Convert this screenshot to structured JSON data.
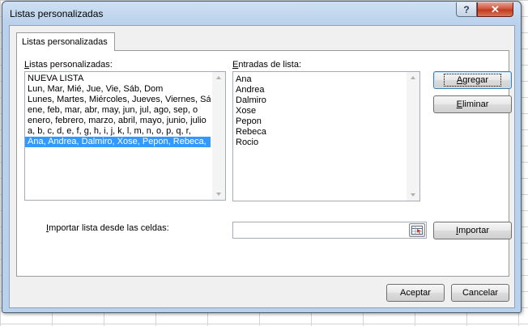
{
  "window": {
    "title": "Listas personalizadas",
    "help": "?",
    "close": "✕"
  },
  "tab": {
    "label": "Listas personalizadas"
  },
  "custom_lists": {
    "label_before": "",
    "label_accel": "L",
    "label_after": "istas personalizadas:",
    "items": [
      "NUEVA LISTA",
      "Lun, Mar, Mié, Jue, Vie, Sáb, Dom",
      "Lunes, Martes, Miércoles, Jueves, Viernes, Sá",
      "ene, feb, mar, abr, may, jun, jul, ago, sep, o",
      "enero, febrero, marzo, abril, mayo, junio, julio",
      "a, b, c, d, e, f, g, h, i, j, k, l, m, n, o, p, q, r,",
      "Ana, Andrea, Dalmiro, Xose, Pepon, Rebeca,"
    ],
    "selected_index": 6
  },
  "list_entries": {
    "label_before": "",
    "label_accel": "E",
    "label_after": "ntradas de lista:",
    "items": [
      "Ana",
      "Andrea",
      "Dalmiro",
      "Xose",
      "Pepon",
      "Rebeca",
      "Rocio"
    ]
  },
  "buttons": {
    "add": {
      "accel": "A",
      "rest": "gregar"
    },
    "delete": {
      "accel": "E",
      "rest": "liminar"
    },
    "import": {
      "accel": "I",
      "rest": "mportar"
    },
    "accept": "Aceptar",
    "cancel": "Cancelar"
  },
  "import_field": {
    "label_before": "",
    "label_accel": "I",
    "label_after": "mportar lista desde las celdas:",
    "value": ""
  },
  "icons": {
    "range_picker": "range-selector-icon",
    "scroll_up": "scroll-up-arrow-icon",
    "scroll_down": "scroll-down-arrow-icon"
  }
}
